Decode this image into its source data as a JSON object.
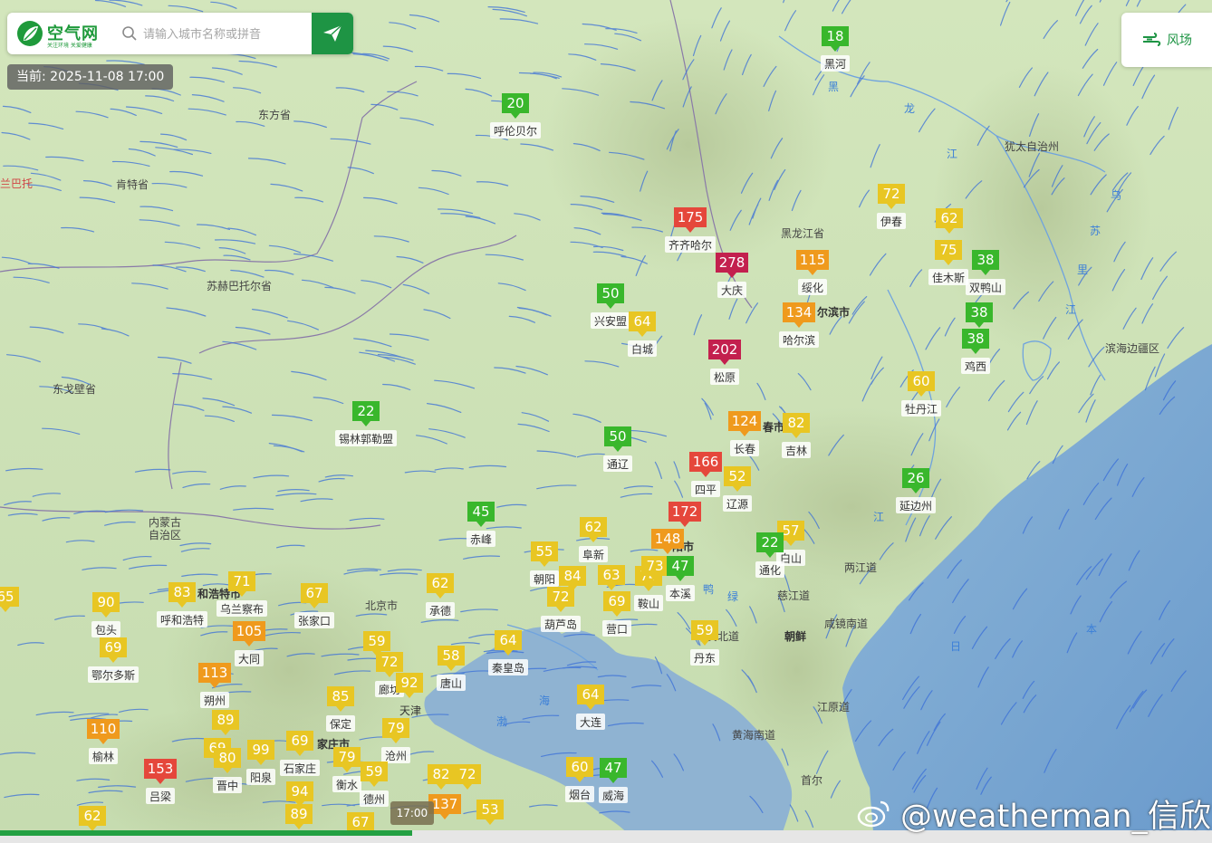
{
  "header": {
    "logo_text": "空气网",
    "logo_sub": "关注环境 关爱健康",
    "search_placeholder": "请输入城市名称或拼音",
    "current_time": "当前: 2025-11-08 17:00",
    "wind_button_label": "风场"
  },
  "timeline": {
    "handle_label": "17:00",
    "progress": 0.34
  },
  "watermark": "@weatherman_信欣",
  "colors": {
    "good": "#39b72c",
    "moderate": "#e8c623",
    "light": "#ef9a1d",
    "medium": "#e5473b",
    "heavy": "#c3204e",
    "accent": "#1e9444"
  },
  "map_labels": [
    {
      "text": "东方省"
    },
    {
      "text": "肯特省"
    },
    {
      "text": "苏赫巴托尔省"
    },
    {
      "text": "东戈壁省"
    },
    {
      "text": "兰巴托"
    },
    {
      "text": "内蒙古\n自治区"
    },
    {
      "text": "黑龙江省"
    },
    {
      "text": "尔滨市"
    },
    {
      "text": "春市"
    },
    {
      "text": "滨海边疆区"
    },
    {
      "text": "犹太自治州"
    },
    {
      "text": "两江道"
    },
    {
      "text": "慈江道"
    },
    {
      "text": "咸镜南道"
    },
    {
      "text": "平安北道"
    },
    {
      "text": "朝鲜"
    },
    {
      "text": "江原道"
    },
    {
      "text": "黄海南道"
    },
    {
      "text": "首尔"
    },
    {
      "text": "北京市"
    },
    {
      "text": "家庄市"
    },
    {
      "text": "和浩特市"
    },
    {
      "text": "阳市"
    },
    {
      "text": "黑"
    },
    {
      "text": "龙"
    },
    {
      "text": "江"
    },
    {
      "text": "乌"
    },
    {
      "text": "苏"
    },
    {
      "text": "里"
    },
    {
      "text": "江"
    },
    {
      "text": "鸭"
    },
    {
      "text": "绿"
    },
    {
      "text": "江"
    },
    {
      "text": "日"
    },
    {
      "text": "本"
    },
    {
      "text": "海"
    },
    {
      "text": "渤"
    }
  ],
  "stations": [
    {
      "aqi": "18",
      "city": "黑河",
      "level": "good"
    },
    {
      "aqi": "20",
      "city": "呼伦贝尔",
      "level": "good"
    },
    {
      "aqi": "175",
      "city": "齐齐哈尔",
      "level": "medium"
    },
    {
      "aqi": "278",
      "city": "大庆",
      "level": "heavy"
    },
    {
      "aqi": "115",
      "city": "绥化",
      "level": "light"
    },
    {
      "aqi": "72",
      "city": "伊春",
      "level": "moderate"
    },
    {
      "aqi": "62",
      "city": "",
      "level": "moderate"
    },
    {
      "aqi": "75",
      "city": "佳木斯",
      "level": "moderate"
    },
    {
      "aqi": "38",
      "city": "双鸭山",
      "level": "good"
    },
    {
      "aqi": "50",
      "city": "兴安盟",
      "level": "good"
    },
    {
      "aqi": "64",
      "city": "白城",
      "level": "moderate"
    },
    {
      "aqi": "134",
      "city": "哈尔滨",
      "level": "light"
    },
    {
      "aqi": "38",
      "city": "",
      "level": "good"
    },
    {
      "aqi": "38",
      "city": "鸡西",
      "level": "good"
    },
    {
      "aqi": "202",
      "city": "松原",
      "level": "heavy"
    },
    {
      "aqi": "60",
      "city": "牡丹江",
      "level": "moderate"
    },
    {
      "aqi": "22",
      "city": "锡林郭勒盟",
      "level": "good"
    },
    {
      "aqi": "124",
      "city": "长春",
      "level": "light"
    },
    {
      "aqi": "82",
      "city": "吉林",
      "level": "moderate"
    },
    {
      "aqi": "50",
      "city": "通辽",
      "level": "good"
    },
    {
      "aqi": "166",
      "city": "四平",
      "level": "medium"
    },
    {
      "aqi": "52",
      "city": "辽源",
      "level": "moderate"
    },
    {
      "aqi": "26",
      "city": "延边州",
      "level": "good"
    },
    {
      "aqi": "45",
      "city": "赤峰",
      "level": "good"
    },
    {
      "aqi": "62",
      "city": "阜新",
      "level": "moderate"
    },
    {
      "aqi": "172",
      "city": "",
      "level": "medium"
    },
    {
      "aqi": "148",
      "city": "",
      "level": "light"
    },
    {
      "aqi": "57",
      "city": "白山",
      "level": "moderate"
    },
    {
      "aqi": "22",
      "city": "通化",
      "level": "good"
    },
    {
      "aqi": "55",
      "city": "朝阳",
      "level": "moderate"
    },
    {
      "aqi": "84",
      "city": "",
      "level": "moderate"
    },
    {
      "aqi": "63",
      "city": "",
      "level": "moderate"
    },
    {
      "aqi": "74",
      "city": "鞍山",
      "level": "moderate"
    },
    {
      "aqi": "73",
      "city": "",
      "level": "moderate"
    },
    {
      "aqi": "47",
      "city": "本溪",
      "level": "good"
    },
    {
      "aqi": "72",
      "city": "葫芦岛",
      "level": "moderate"
    },
    {
      "aqi": "69",
      "city": "营口",
      "level": "moderate"
    },
    {
      "aqi": "59",
      "city": "丹东",
      "level": "moderate"
    },
    {
      "aqi": "62",
      "city": "承德",
      "level": "moderate"
    },
    {
      "aqi": "65",
      "city": "",
      "level": "moderate"
    },
    {
      "aqi": "90",
      "city": "包头",
      "level": "moderate"
    },
    {
      "aqi": "83",
      "city": "呼和浩特",
      "level": "moderate"
    },
    {
      "aqi": "71",
      "city": "乌兰察布",
      "level": "moderate"
    },
    {
      "aqi": "67",
      "city": "张家口",
      "level": "moderate"
    },
    {
      "aqi": "105",
      "city": "大同",
      "level": "light"
    },
    {
      "aqi": "69",
      "city": "鄂尔多斯",
      "level": "moderate"
    },
    {
      "aqi": "59",
      "city": "",
      "level": "moderate"
    },
    {
      "aqi": "72",
      "city": "廊坊",
      "level": "moderate"
    },
    {
      "aqi": "58",
      "city": "唐山",
      "level": "moderate"
    },
    {
      "aqi": "64",
      "city": "秦皇岛",
      "level": "moderate"
    },
    {
      "aqi": "92",
      "city": "",
      "level": "moderate"
    },
    {
      "aqi": "113",
      "city": "朔州",
      "level": "light"
    },
    {
      "aqi": "85",
      "city": "保定",
      "level": "moderate"
    },
    {
      "aqi": "天津",
      "city": "",
      "level": "none"
    },
    {
      "aqi": "89",
      "city": "",
      "level": "moderate"
    },
    {
      "aqi": "79",
      "city": "沧州",
      "level": "moderate"
    },
    {
      "aqi": "64",
      "city": "大连",
      "level": "moderate"
    },
    {
      "aqi": "110",
      "city": "榆林",
      "level": "light"
    },
    {
      "aqi": "69",
      "city": "",
      "level": "moderate"
    },
    {
      "aqi": "80",
      "city": "晋中",
      "level": "moderate"
    },
    {
      "aqi": "99",
      "city": "阳泉",
      "level": "moderate"
    },
    {
      "aqi": "69",
      "city": "石家庄",
      "level": "moderate"
    },
    {
      "aqi": "79",
      "city": "衡水",
      "level": "moderate"
    },
    {
      "aqi": "59",
      "city": "德州",
      "level": "moderate"
    },
    {
      "aqi": "82",
      "city": "",
      "level": "moderate"
    },
    {
      "aqi": "72",
      "city": "",
      "level": "moderate"
    },
    {
      "aqi": "60",
      "city": "烟台",
      "level": "moderate"
    },
    {
      "aqi": "47",
      "city": "威海",
      "level": "good"
    },
    {
      "aqi": "153",
      "city": "吕梁",
      "level": "medium"
    },
    {
      "aqi": "94",
      "city": "",
      "level": "moderate"
    },
    {
      "aqi": "137",
      "city": "",
      "level": "light"
    },
    {
      "aqi": "53",
      "city": "",
      "level": "moderate"
    },
    {
      "aqi": "62",
      "city": "",
      "level": "moderate"
    },
    {
      "aqi": "89",
      "city": "",
      "level": "moderate"
    },
    {
      "aqi": "67",
      "city": "",
      "level": "moderate"
    }
  ]
}
